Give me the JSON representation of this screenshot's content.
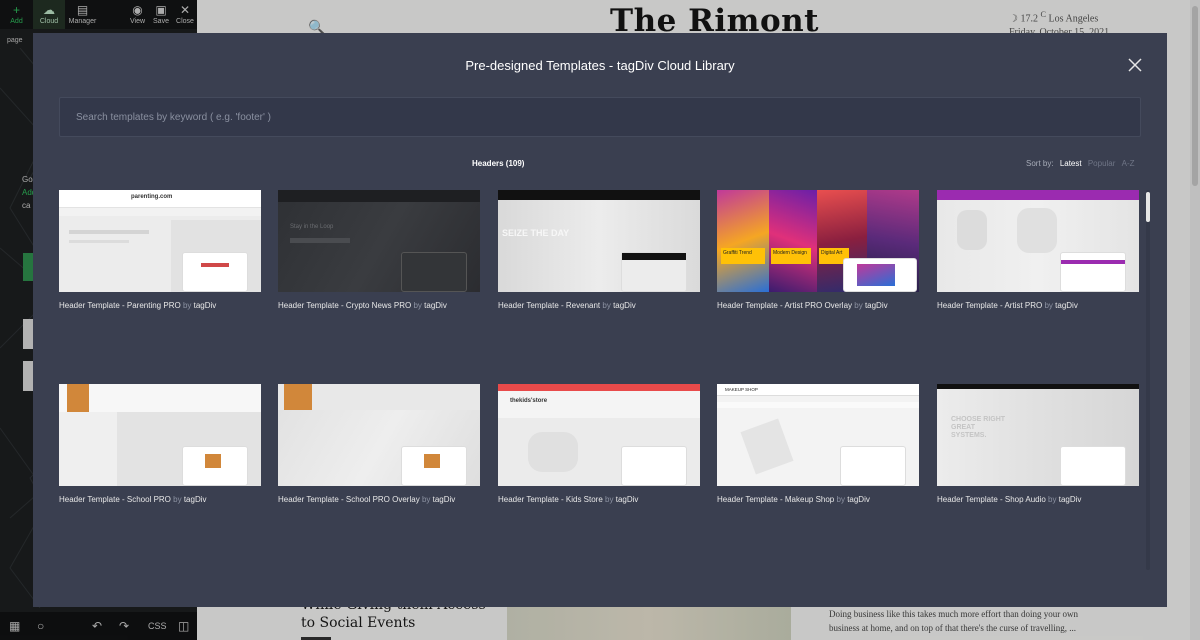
{
  "site": {
    "logo": "The Rimont",
    "weather": "17.2",
    "weather_unit": "C",
    "city": "Los Angeles",
    "date": "Friday, October 15, 2021",
    "headline": "While Giving them Access to Social Events",
    "body_text": "Doing business like this takes much more effort than doing your own business at home, and on top of that there's the curse of travelling, ..."
  },
  "editor": {
    "tools": {
      "add": "Add",
      "cloud": "Cloud",
      "manager": "Manager",
      "view": "View",
      "save": "Save",
      "close": "Close"
    },
    "page_label": "page",
    "snippets": [
      "Go",
      "Add",
      "ca"
    ],
    "bottom_css": "CSS"
  },
  "modal": {
    "title": "Pre-designed Templates - tagDiv Cloud Library",
    "search_placeholder": "Search templates by keyword ( e.g. 'footer' )",
    "category": "Headers (109)",
    "sort_label": "Sort by:",
    "sort_options": [
      "Latest",
      "Popular",
      "A-Z"
    ],
    "active_sort": "Latest",
    "templates": [
      {
        "name": "Header Template - Parenting PRO",
        "by": "by",
        "author": "tagDiv",
        "theme": "parenting",
        "thumb_text": "parenting.com"
      },
      {
        "name": "Header Template - Crypto News PRO",
        "by": "by",
        "author": "tagDiv",
        "theme": "crypto",
        "thumb_text": "Stay in the Loop"
      },
      {
        "name": "Header Template - Revenant",
        "by": "by",
        "author": "tagDiv",
        "theme": "revenant",
        "thumb_text": "SEIZE THE DAY"
      },
      {
        "name": "Header Template - Artist PRO Overlay",
        "by": "by",
        "author": "tagDiv",
        "theme": "artist-overlay",
        "thumb_text": [
          "Graffiti Trend",
          "Modern Design",
          "Digital Art"
        ]
      },
      {
        "name": "Header Template - Artist PRO",
        "by": "by",
        "author": "tagDiv",
        "theme": "artist",
        "thumb_text": ""
      },
      {
        "name": "Header Template - School PRO",
        "by": "by",
        "author": "tagDiv",
        "theme": "school",
        "thumb_text": ""
      },
      {
        "name": "Header Template - School PRO Overlay",
        "by": "by",
        "author": "tagDiv",
        "theme": "school-overlay",
        "thumb_text": ""
      },
      {
        "name": "Header Template - Kids Store",
        "by": "by",
        "author": "tagDiv",
        "theme": "kids",
        "thumb_text": "thekids'store"
      },
      {
        "name": "Header Template - Makeup Shop",
        "by": "by",
        "author": "tagDiv",
        "theme": "makeup",
        "thumb_text": "MAKEUP SHOP"
      },
      {
        "name": "Header Template - Shop Audio",
        "by": "by",
        "author": "tagDiv",
        "theme": "audio",
        "thumb_text": "CHOOSE RIGHT GREAT SYSTEMS."
      }
    ]
  },
  "colors": {
    "modal_bg": "#3a3f50",
    "accent_green": "#2fbf5d",
    "artist_purple": "#9b2bb0",
    "artist_yellow": "#ffc107",
    "kids_red": "#e84a4a",
    "school_orange": "#d1873a"
  },
  "icons": [
    "plus-icon",
    "cloud-icon",
    "manager-icon",
    "eye-icon",
    "save-icon",
    "close-icon",
    "search-icon",
    "moon-icon",
    "undo-icon",
    "redo-icon"
  ]
}
